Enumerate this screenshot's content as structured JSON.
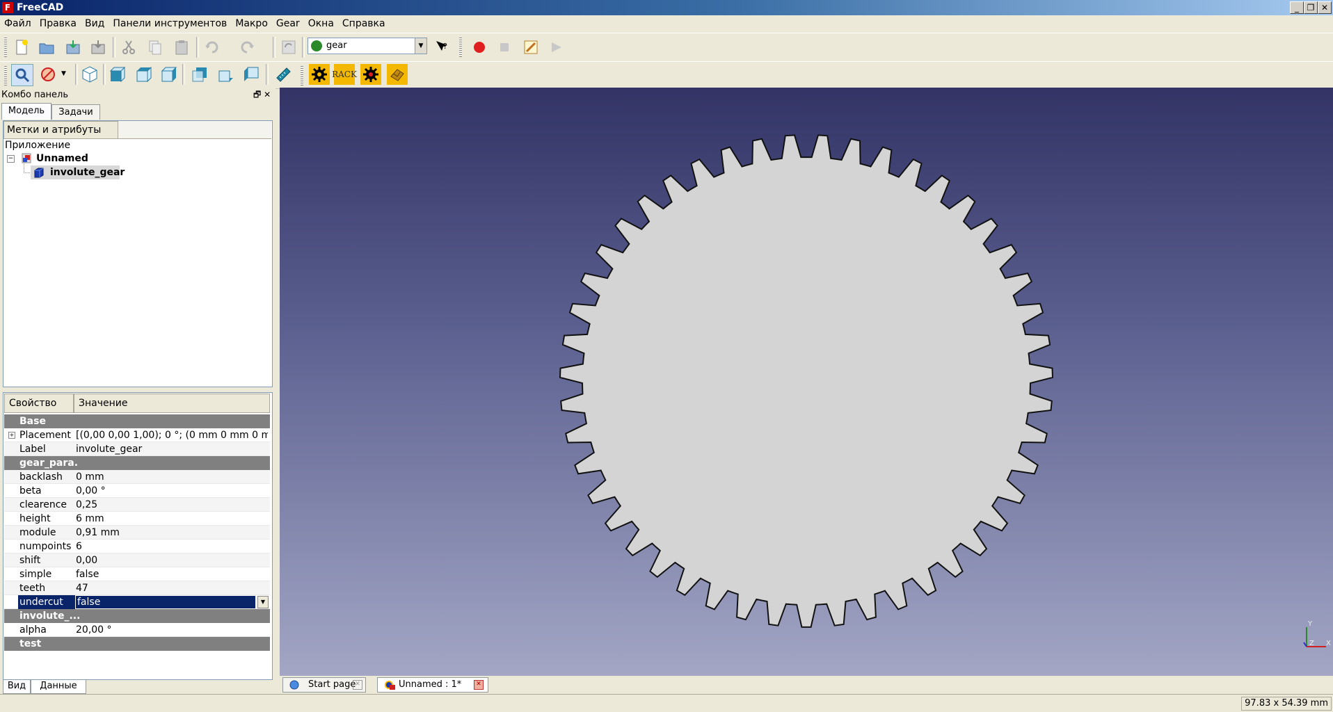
{
  "window": {
    "title": "FreeCAD",
    "controls": [
      "_",
      "❐",
      "✕"
    ]
  },
  "menu": [
    "Файл",
    "Правка",
    "Вид",
    "Панели инструментов",
    "Макро",
    "Gear",
    "Окна",
    "Справка"
  ],
  "workbench": {
    "selected": "gear"
  },
  "combo_panel": {
    "title": "Комбо панель",
    "tabs": [
      "Модель",
      "Задачи"
    ],
    "tree_header": "Метки и атрибуты",
    "tree": {
      "root": "Приложение",
      "document": "Unnamed",
      "object": "involute_gear"
    },
    "property_headers": {
      "property": "Свойство",
      "value": "Значение"
    },
    "properties": [
      {
        "group": "Base"
      },
      {
        "key": "Placement",
        "value": "[(0,00 0,00 1,00); 0 °; (0 mm  0 mm  0 m..."
      },
      {
        "key": "Label",
        "value": "involute_gear"
      },
      {
        "group": "gear_para."
      },
      {
        "key": "backlash",
        "value": "0 mm"
      },
      {
        "key": "beta",
        "value": "0,00 °"
      },
      {
        "key": "clearence",
        "value": "0,25"
      },
      {
        "key": "height",
        "value": "6 mm"
      },
      {
        "key": "module",
        "value": "0,91 mm"
      },
      {
        "key": "numpoints",
        "value": "6"
      },
      {
        "key": "shift",
        "value": "0,00"
      },
      {
        "key": "simple",
        "value": "false"
      },
      {
        "key": "teeth",
        "value": "47"
      },
      {
        "key": "undercut",
        "value": "false",
        "selected": true
      },
      {
        "group": "involute_..."
      },
      {
        "key": "alpha",
        "value": "20,00 °"
      },
      {
        "group": "test"
      }
    ],
    "bottom_tabs": [
      "Вид",
      "Данные"
    ]
  },
  "gear": {
    "teeth": 47,
    "fill": "#d4d4d4",
    "outline": "#111111"
  },
  "axis": {
    "x": "X",
    "y": "Y",
    "z": "Z"
  },
  "document_tabs": [
    {
      "label": "Start page",
      "active": false
    },
    {
      "label": "Unnamed : 1*",
      "active": true
    }
  ],
  "status": {
    "dimensions": "97.83 x 54.39 mm"
  },
  "toolbar2": {
    "rack_label": "RACK"
  }
}
